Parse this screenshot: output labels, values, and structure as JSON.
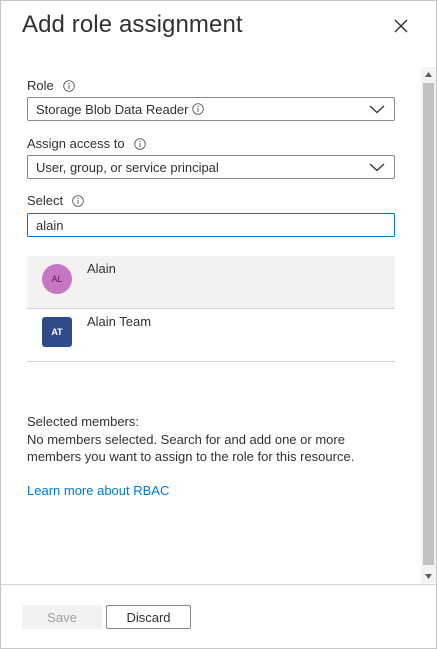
{
  "header": {
    "title": "Add role assignment",
    "close_icon": "close-icon"
  },
  "role": {
    "label": "Role",
    "value": "Storage Blob Data Reader"
  },
  "assign_access": {
    "label": "Assign access to",
    "value": "User, group, or service principal"
  },
  "select": {
    "label": "Select",
    "search_value": "alain"
  },
  "results": [
    {
      "initials": "AL",
      "name": "Alain",
      "avatar_color": "#c776c3",
      "selected": true
    },
    {
      "initials": "AT",
      "name": "Alain Team",
      "avatar_color": "#2f4b8a",
      "selected": false
    }
  ],
  "selected_members": {
    "title": "Selected members:",
    "description": "No members selected. Search for and add one or more members you want to assign to the role for this resource."
  },
  "learn_more": "Learn more about RBAC",
  "footer": {
    "save_label": "Save",
    "discard_label": "Discard"
  },
  "colors": {
    "accent": "#0078d4",
    "border": "#8a8886"
  }
}
